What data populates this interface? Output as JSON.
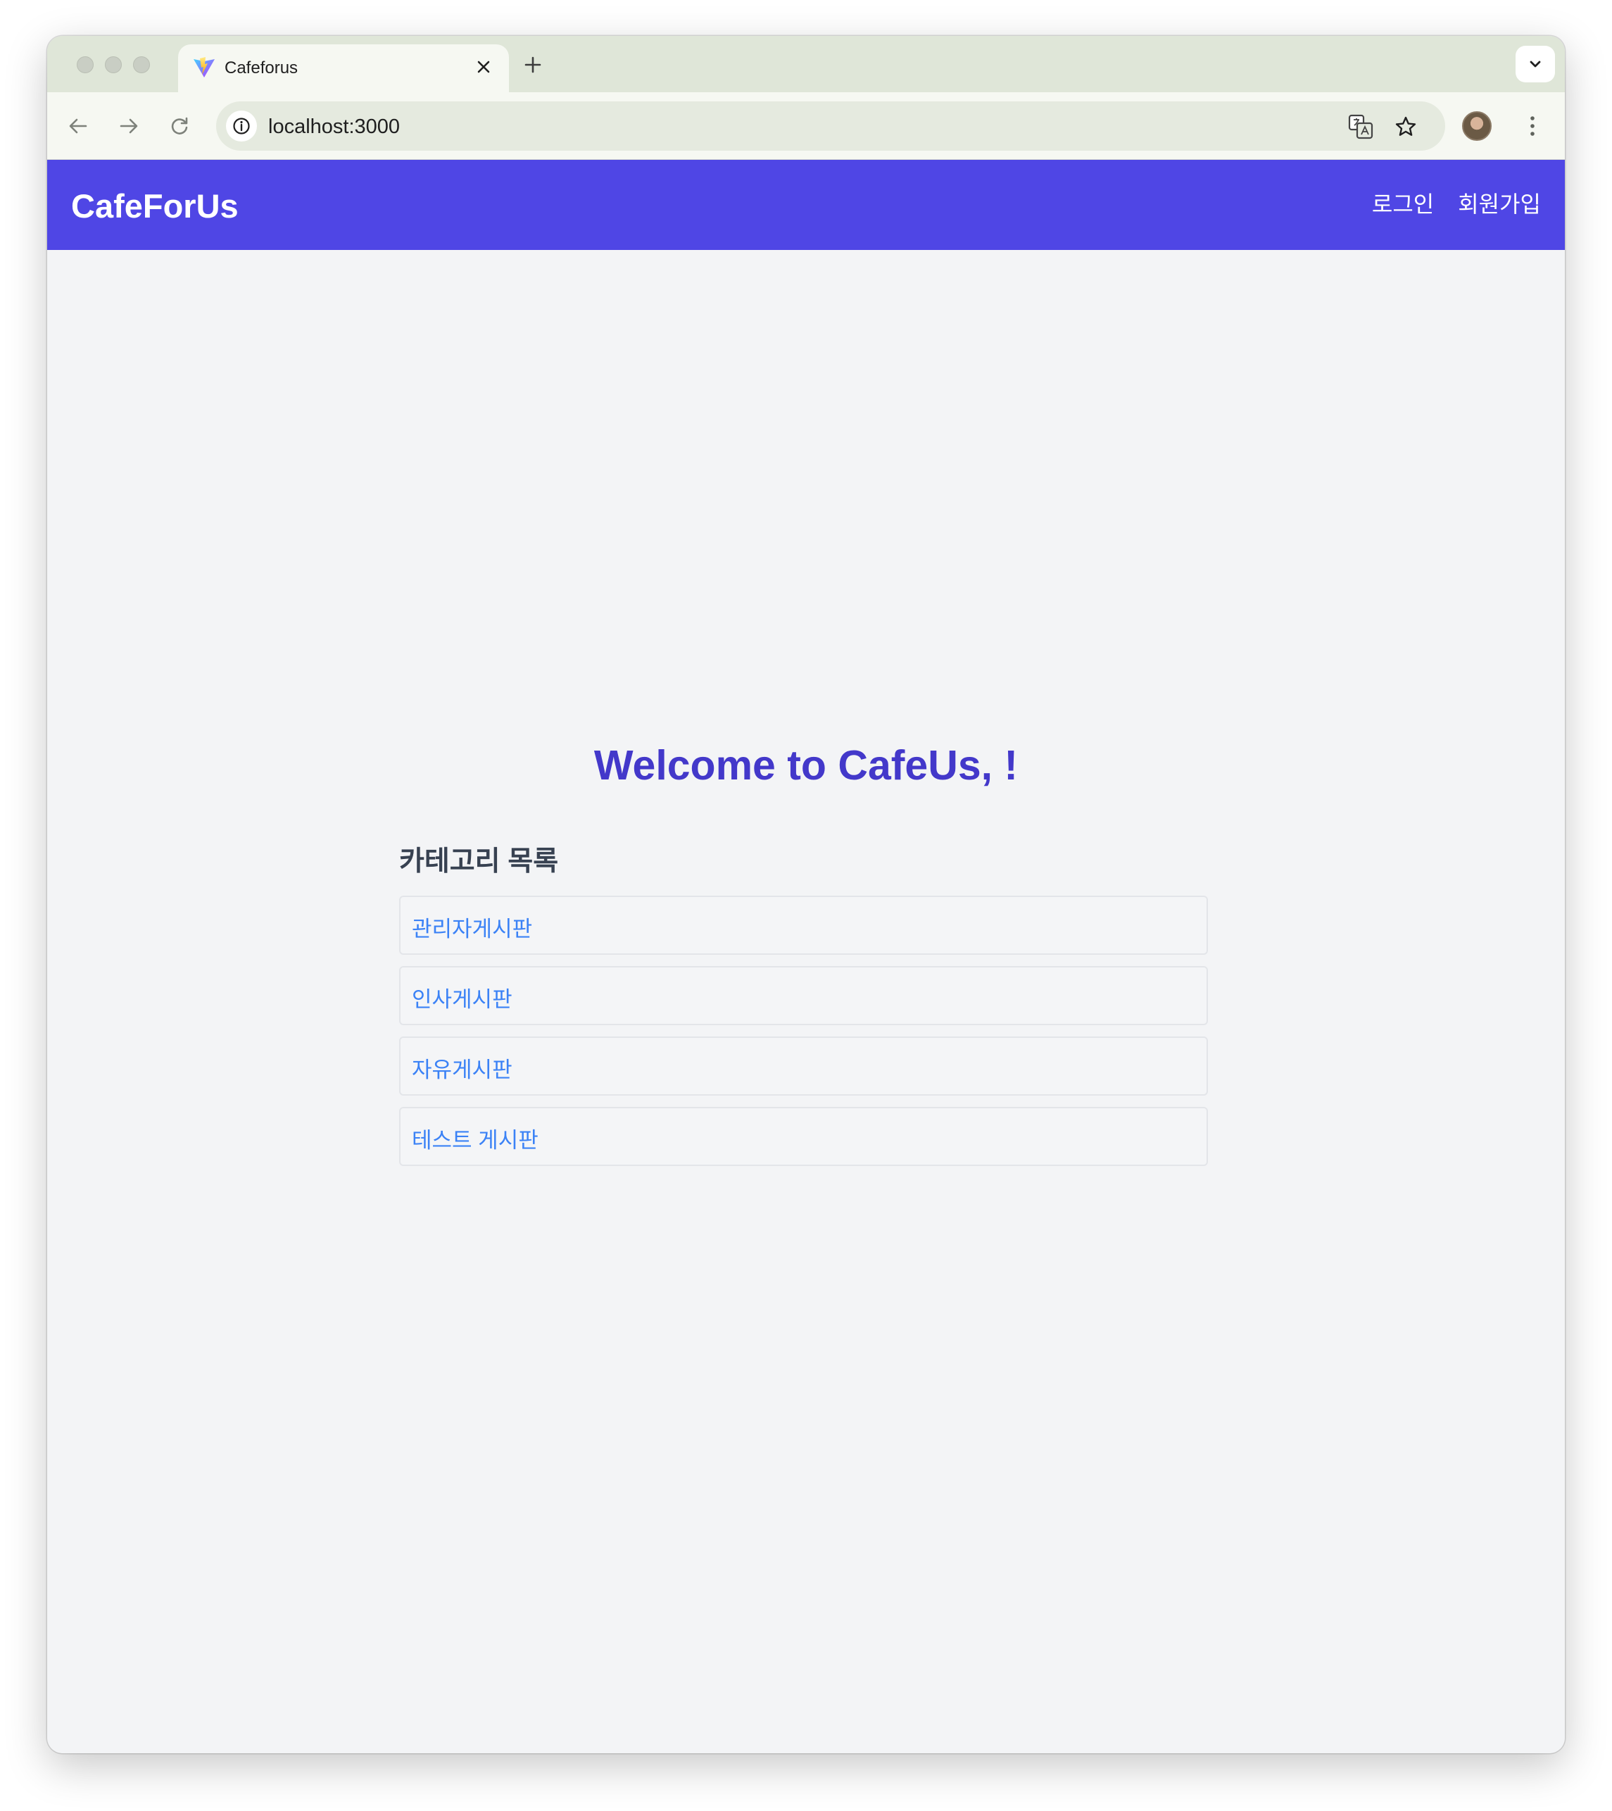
{
  "browser": {
    "tab": {
      "title": "Cafeforus"
    },
    "address_bar": {
      "url": "localhost:3000"
    }
  },
  "app": {
    "brand": "CafeForUs",
    "nav": {
      "login": "로그인",
      "signup": "회원가입"
    }
  },
  "main": {
    "welcome": "Welcome to CafeUs, !",
    "category_heading": "카테고리 목록",
    "categories": [
      {
        "label": "관리자게시판"
      },
      {
        "label": "인사게시판"
      },
      {
        "label": "자유게시판"
      },
      {
        "label": "테스트 게시판"
      }
    ]
  },
  "colors": {
    "header_bg": "#4f46e5",
    "welcome_text": "#4338ca",
    "link_text": "#3b82f6",
    "page_bg": "#f3f4f6"
  },
  "icons": [
    "vite-favicon-icon",
    "close-icon",
    "plus-icon",
    "chevron-down-icon",
    "back-arrow-icon",
    "forward-arrow-icon",
    "reload-icon",
    "info-icon",
    "translate-icon",
    "star-icon",
    "avatar",
    "kebab-menu-icon"
  ]
}
